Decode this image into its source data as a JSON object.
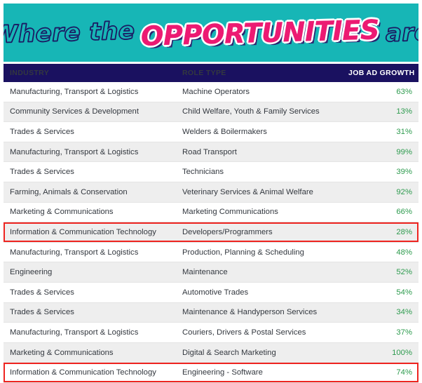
{
  "banner": {
    "title_part1": "Where the",
    "title_part2": "OPPORTUNITIES",
    "title_part3": "are",
    "background_color": "#17b6b6",
    "outline_text_color": "#1b1a63",
    "accent_text_color": "#ec1a72"
  },
  "table": {
    "header_background": "#1a1160",
    "growth_value_color": "#2d9b4e",
    "highlight_border_color": "#ee2420",
    "columns": [
      {
        "key": "industry",
        "label": "INDUSTRY"
      },
      {
        "key": "role",
        "label": "ROLE TYPE"
      },
      {
        "key": "growth",
        "label": "JOB AD GROWTH"
      }
    ],
    "rows": [
      {
        "industry": "Manufacturing, Transport & Logistics",
        "role": "Machine Operators",
        "growth": "63%",
        "highlight": false
      },
      {
        "industry": "Community Services & Development",
        "role": "Child Welfare, Youth & Family Services",
        "growth": "13%",
        "highlight": false
      },
      {
        "industry": "Trades & Services",
        "role": "Welders & Boilermakers",
        "growth": "31%",
        "highlight": false
      },
      {
        "industry": "Manufacturing, Transport & Logistics",
        "role": "Road Transport",
        "growth": "99%",
        "highlight": false
      },
      {
        "industry": "Trades & Services",
        "role": "Technicians",
        "growth": "39%",
        "highlight": false
      },
      {
        "industry": "Farming, Animals & Conservation",
        "role": "Veterinary Services & Animal Welfare",
        "growth": "92%",
        "highlight": false
      },
      {
        "industry": "Marketing & Communications",
        "role": "Marketing Communications",
        "growth": "66%",
        "highlight": false
      },
      {
        "industry": "Information & Communication Technology",
        "role": "Developers/Programmers",
        "growth": "28%",
        "highlight": true
      },
      {
        "industry": "Manufacturing, Transport & Logistics",
        "role": "Production, Planning & Scheduling",
        "growth": "48%",
        "highlight": false
      },
      {
        "industry": "Engineering",
        "role": "Maintenance",
        "growth": "52%",
        "highlight": false
      },
      {
        "industry": "Trades & Services",
        "role": "Automotive Trades",
        "growth": "54%",
        "highlight": false
      },
      {
        "industry": "Trades & Services",
        "role": "Maintenance & Handyperson Services",
        "growth": "34%",
        "highlight": false
      },
      {
        "industry": "Manufacturing, Transport & Logistics",
        "role": "Couriers, Drivers & Postal Services",
        "growth": "37%",
        "highlight": false
      },
      {
        "industry": "Marketing & Communications",
        "role": "Digital & Search Marketing",
        "growth": "100%",
        "highlight": false
      },
      {
        "industry": "Information & Communication Technology",
        "role": "Engineering - Software",
        "growth": "74%",
        "highlight": true
      }
    ]
  }
}
